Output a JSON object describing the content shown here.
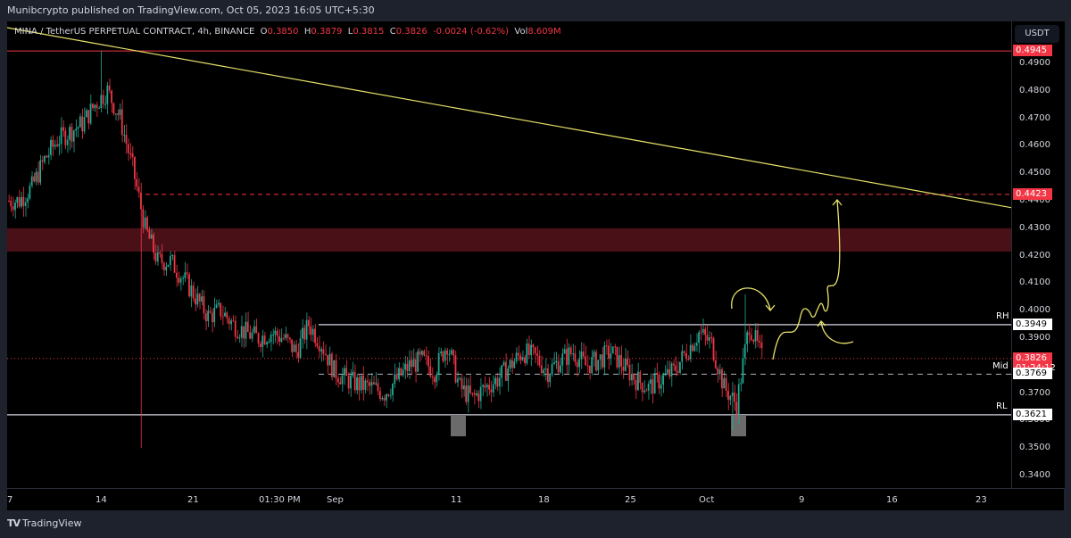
{
  "header": {
    "published": "Munibcrypto published on TradingView.com, Oct 05, 2023 16:05 UTC+5:30"
  },
  "legend": {
    "symbol": "MINA / TetherUS PERPETUAL CONTRACT, 4h, BINANCE",
    "o_label": "O",
    "o": "0.3850",
    "h_label": "H",
    "h": "0.3879",
    "l_label": "L",
    "l": "0.3815",
    "c_label": "C",
    "c": "0.3826",
    "change": "-0.0024 (-0.62%)",
    "vol_label": "Vol",
    "vol": "8.609M"
  },
  "currency": "USDT",
  "colors": {
    "up": "#22ab94",
    "down": "#f23645",
    "trendline": "#e8e36b",
    "zone": "#4a1018",
    "level": "#b2b5be"
  },
  "price_labels": {
    "top": "0.4945",
    "target": "0.4423",
    "rh": "0.3949",
    "current": "0.3826",
    "countdown": "01:24:12",
    "mid": "0.3769",
    "rl": "0.3621"
  },
  "level_names": {
    "rh": "RH",
    "mid": "Mid",
    "rl": "RL"
  },
  "brand": "TradingView",
  "chart_data": {
    "type": "candlestick",
    "timeframe": "4h",
    "y_ticks": [
      "0.4900",
      "0.4800",
      "0.4700",
      "0.4600",
      "0.4500",
      "0.4400",
      "0.4300",
      "0.4200",
      "0.4100",
      "0.4000",
      "0.3900",
      "0.3800",
      "0.3700",
      "0.3600",
      "0.3500",
      "0.3400"
    ],
    "x_ticks": [
      "7",
      "14",
      "21",
      "01:30 PM",
      "Sep",
      "11",
      "18",
      "25",
      "Oct",
      "9",
      "16",
      "23"
    ],
    "ylim": [
      0.335,
      0.505
    ],
    "daily_closes_from_aug_7": [
      0.44,
      0.445,
      0.455,
      0.462,
      0.465,
      0.468,
      0.475,
      0.48,
      0.47,
      0.452,
      0.43,
      0.418,
      0.418,
      0.412,
      0.405,
      0.398,
      0.4,
      0.395,
      0.392,
      0.39,
      0.392,
      0.39,
      0.385,
      0.395,
      0.388,
      0.378,
      0.375,
      0.373,
      0.372,
      0.37,
      0.375,
      0.38,
      0.382,
      0.378,
      0.388,
      0.372,
      0.368,
      0.372,
      0.375,
      0.38,
      0.385,
      0.383,
      0.378,
      0.382,
      0.385,
      0.38,
      0.382,
      0.385,
      0.38,
      0.375,
      0.372,
      0.375,
      0.378,
      0.385,
      0.392,
      0.388,
      0.372,
      0.366,
      0.395,
      0.383
    ],
    "levels": {
      "resistance_high": 0.3949,
      "mid": 0.3769,
      "range_low": 0.3621,
      "target": 0.4423,
      "high": 0.4945,
      "current": 0.3826
    },
    "zone": [
      0.4215,
      0.43
    ],
    "trendline": [
      0.503,
      0.4375
    ]
  }
}
